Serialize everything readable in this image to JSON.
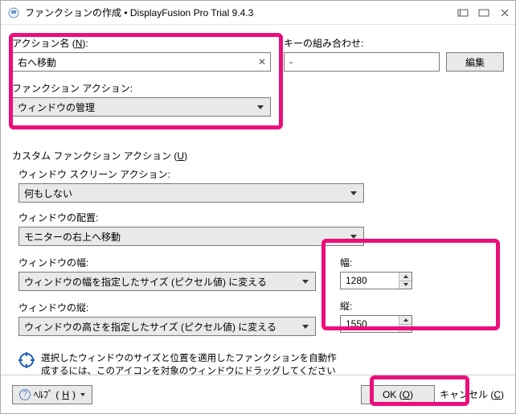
{
  "titlebar": {
    "title": "ファンクションの作成 • DisplayFusion Pro Trial 9.4.3"
  },
  "top": {
    "action_name_label_pre": "アクション名 (",
    "action_name_mn": "N",
    "action_name_label_post": "):",
    "action_name_value": "右へ移動",
    "function_action_label": "ファンクション アクション:",
    "function_action_value": "ウィンドウの管理",
    "key_combo_label": "キーの組み合わせ:",
    "key_combo_value": "-",
    "edit_button": "編集"
  },
  "custom": {
    "header_pre": "カスタム ファンクション アクション (",
    "header_mn": "U",
    "header_post": ")",
    "screen_action_label": "ウィンドウ スクリーン アクション:",
    "screen_action_value": "何もしない",
    "placement_label": "ウィンドウの配置:",
    "placement_value": "モニターの右上へ移動",
    "width_label": "ウィンドウの幅:",
    "width_value": "ウィンドウの幅を指定したサイズ (ピクセル値) に変える",
    "height_label": "ウィンドウの縦:",
    "height_value": "ウィンドウの高さを指定したサイズ (ピクセル値) に変える",
    "width_num_label": "幅:",
    "width_num_value": "1280",
    "height_num_label": "縦:",
    "height_num_value": "1550",
    "tip_text": "選択したウィンドウのサイズと位置を適用したファンクションを自動作成するには、このアイコンを対象のウィンドウにドラッグしてください"
  },
  "footer": {
    "help_pre": "ﾍﾙﾌﾟ (",
    "help_mn": "H",
    "help_post": ")",
    "ok_pre": "OK (",
    "ok_mn": "O",
    "ok_post": ")",
    "cancel_pre": "キャンセル (",
    "cancel_mn": "C",
    "cancel_post": ")"
  }
}
